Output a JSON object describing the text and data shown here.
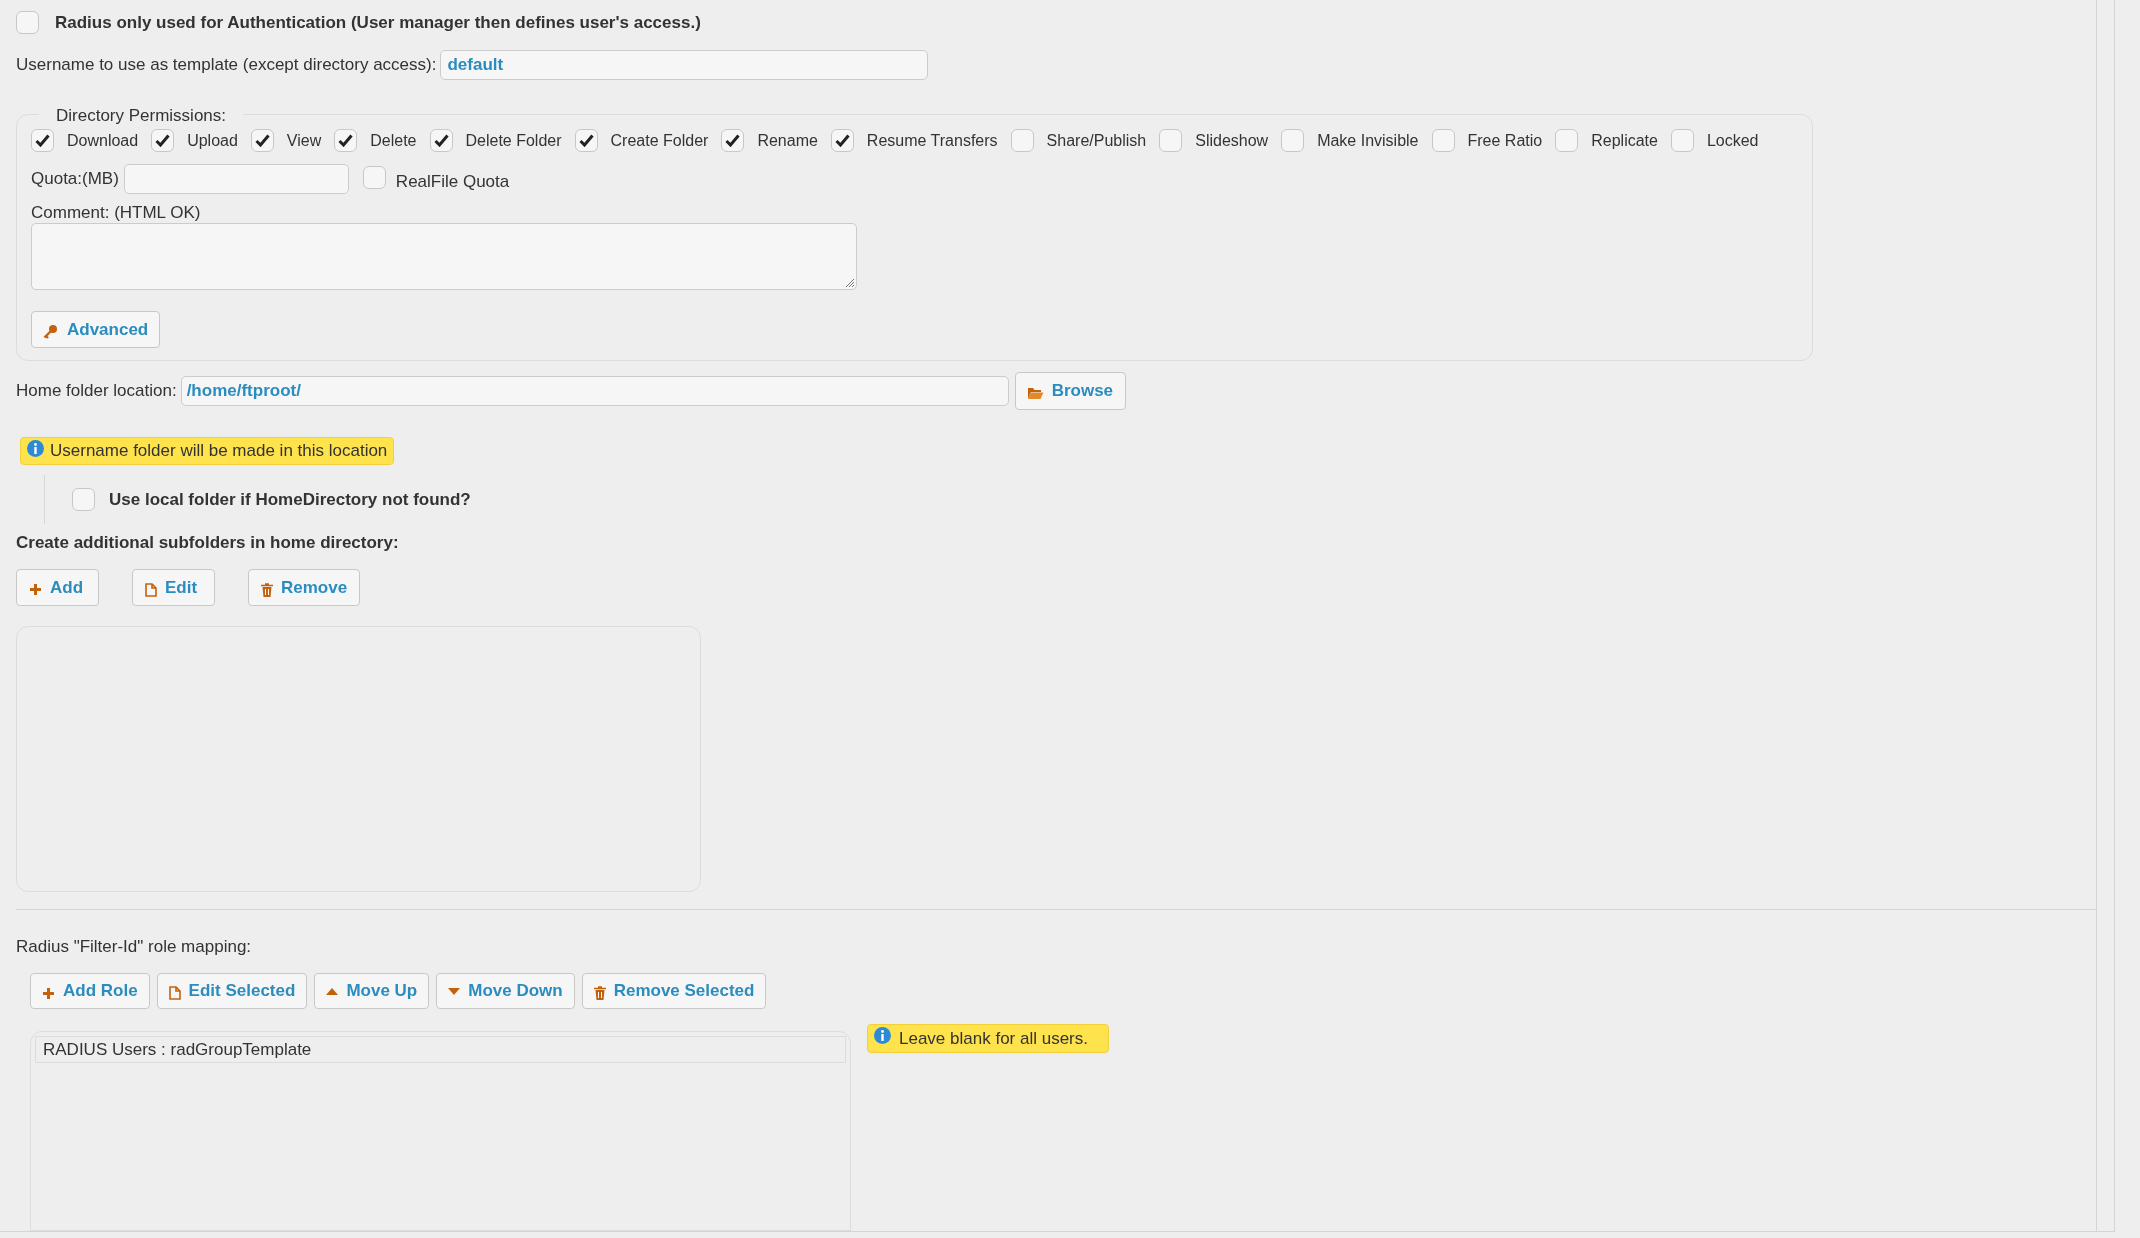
{
  "radius_only": {
    "label": "Radius only used for Authentication (User manager then defines user's access.)",
    "checked": false
  },
  "template": {
    "label": "Username to use as template (except directory access):",
    "value": "default"
  },
  "directory_permissions": {
    "legend": "Directory Permissions:",
    "permissions": [
      {
        "label": "Download",
        "checked": true
      },
      {
        "label": "Upload",
        "checked": true
      },
      {
        "label": "View",
        "checked": true
      },
      {
        "label": "Delete",
        "checked": true
      },
      {
        "label": "Delete Folder",
        "checked": true
      },
      {
        "label": "Create Folder",
        "checked": true
      },
      {
        "label": "Rename",
        "checked": true
      },
      {
        "label": "Resume Transfers",
        "checked": true
      },
      {
        "label": "Share/Publish",
        "checked": false
      },
      {
        "label": "Slideshow",
        "checked": false
      },
      {
        "label": "Make Invisible",
        "checked": false
      },
      {
        "label": "Free Ratio",
        "checked": false
      },
      {
        "label": "Replicate",
        "checked": false
      },
      {
        "label": "Locked",
        "checked": false
      }
    ],
    "quota": {
      "label": "Quota:(MB)"
    },
    "realfile_quota": {
      "label": "RealFile Quota",
      "checked": false
    },
    "comment": {
      "label": "Comment: (HTML OK)"
    },
    "advanced_button": {
      "label": "Advanced",
      "kind": "key"
    }
  },
  "home_folder": {
    "label": "Home folder location:",
    "value": "/home/ftproot/",
    "browse_button": {
      "label": "Browse",
      "kind": "folder"
    }
  },
  "home_note": "Username folder will be made in this location",
  "use_local_folder": {
    "label": "Use local folder if HomeDirectory not found?",
    "checked": false
  },
  "subfolders": {
    "heading": "Create additional subfolders in home directory:",
    "buttons": [
      {
        "label": "Add",
        "kind": "add"
      },
      {
        "label": "Edit",
        "kind": "edit"
      },
      {
        "label": "Remove",
        "kind": "remove"
      }
    ]
  },
  "role_mapping": {
    "heading": "Radius \"Filter-Id\" role mapping:",
    "buttons": [
      {
        "label": "Add Role",
        "kind": "add"
      },
      {
        "label": "Edit Selected",
        "kind": "edit"
      },
      {
        "label": "Move Up",
        "kind": "up"
      },
      {
        "label": "Move Down",
        "kind": "down"
      },
      {
        "label": "Remove Selected",
        "kind": "remove"
      }
    ],
    "roles": [
      {
        "label": "RADIUS Users : radGroupTemplate",
        "selected": false
      }
    ],
    "note": "Leave blank for all users."
  }
}
